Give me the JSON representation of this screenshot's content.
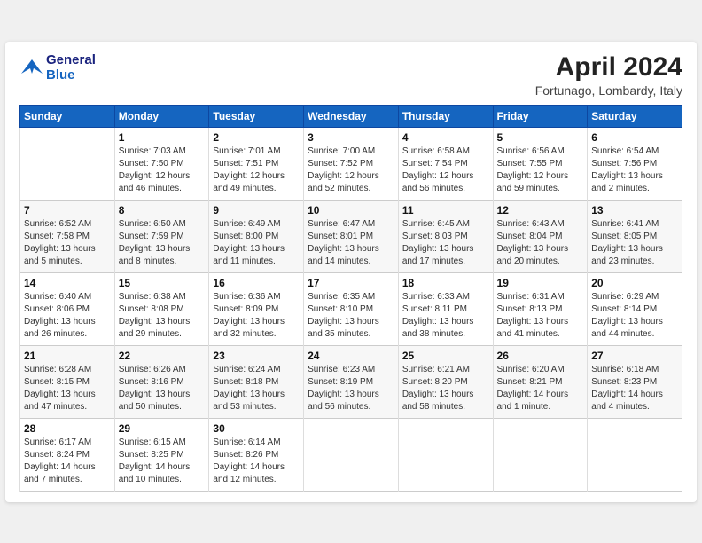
{
  "header": {
    "logo_line1": "General",
    "logo_line2": "Blue",
    "month": "April 2024",
    "location": "Fortunago, Lombardy, Italy"
  },
  "weekdays": [
    "Sunday",
    "Monday",
    "Tuesday",
    "Wednesday",
    "Thursday",
    "Friday",
    "Saturday"
  ],
  "weeks": [
    [
      {
        "day": "",
        "info": ""
      },
      {
        "day": "1",
        "info": "Sunrise: 7:03 AM\nSunset: 7:50 PM\nDaylight: 12 hours\nand 46 minutes."
      },
      {
        "day": "2",
        "info": "Sunrise: 7:01 AM\nSunset: 7:51 PM\nDaylight: 12 hours\nand 49 minutes."
      },
      {
        "day": "3",
        "info": "Sunrise: 7:00 AM\nSunset: 7:52 PM\nDaylight: 12 hours\nand 52 minutes."
      },
      {
        "day": "4",
        "info": "Sunrise: 6:58 AM\nSunset: 7:54 PM\nDaylight: 12 hours\nand 56 minutes."
      },
      {
        "day": "5",
        "info": "Sunrise: 6:56 AM\nSunset: 7:55 PM\nDaylight: 12 hours\nand 59 minutes."
      },
      {
        "day": "6",
        "info": "Sunrise: 6:54 AM\nSunset: 7:56 PM\nDaylight: 13 hours\nand 2 minutes."
      }
    ],
    [
      {
        "day": "7",
        "info": "Sunrise: 6:52 AM\nSunset: 7:58 PM\nDaylight: 13 hours\nand 5 minutes."
      },
      {
        "day": "8",
        "info": "Sunrise: 6:50 AM\nSunset: 7:59 PM\nDaylight: 13 hours\nand 8 minutes."
      },
      {
        "day": "9",
        "info": "Sunrise: 6:49 AM\nSunset: 8:00 PM\nDaylight: 13 hours\nand 11 minutes."
      },
      {
        "day": "10",
        "info": "Sunrise: 6:47 AM\nSunset: 8:01 PM\nDaylight: 13 hours\nand 14 minutes."
      },
      {
        "day": "11",
        "info": "Sunrise: 6:45 AM\nSunset: 8:03 PM\nDaylight: 13 hours\nand 17 minutes."
      },
      {
        "day": "12",
        "info": "Sunrise: 6:43 AM\nSunset: 8:04 PM\nDaylight: 13 hours\nand 20 minutes."
      },
      {
        "day": "13",
        "info": "Sunrise: 6:41 AM\nSunset: 8:05 PM\nDaylight: 13 hours\nand 23 minutes."
      }
    ],
    [
      {
        "day": "14",
        "info": "Sunrise: 6:40 AM\nSunset: 8:06 PM\nDaylight: 13 hours\nand 26 minutes."
      },
      {
        "day": "15",
        "info": "Sunrise: 6:38 AM\nSunset: 8:08 PM\nDaylight: 13 hours\nand 29 minutes."
      },
      {
        "day": "16",
        "info": "Sunrise: 6:36 AM\nSunset: 8:09 PM\nDaylight: 13 hours\nand 32 minutes."
      },
      {
        "day": "17",
        "info": "Sunrise: 6:35 AM\nSunset: 8:10 PM\nDaylight: 13 hours\nand 35 minutes."
      },
      {
        "day": "18",
        "info": "Sunrise: 6:33 AM\nSunset: 8:11 PM\nDaylight: 13 hours\nand 38 minutes."
      },
      {
        "day": "19",
        "info": "Sunrise: 6:31 AM\nSunset: 8:13 PM\nDaylight: 13 hours\nand 41 minutes."
      },
      {
        "day": "20",
        "info": "Sunrise: 6:29 AM\nSunset: 8:14 PM\nDaylight: 13 hours\nand 44 minutes."
      }
    ],
    [
      {
        "day": "21",
        "info": "Sunrise: 6:28 AM\nSunset: 8:15 PM\nDaylight: 13 hours\nand 47 minutes."
      },
      {
        "day": "22",
        "info": "Sunrise: 6:26 AM\nSunset: 8:16 PM\nDaylight: 13 hours\nand 50 minutes."
      },
      {
        "day": "23",
        "info": "Sunrise: 6:24 AM\nSunset: 8:18 PM\nDaylight: 13 hours\nand 53 minutes."
      },
      {
        "day": "24",
        "info": "Sunrise: 6:23 AM\nSunset: 8:19 PM\nDaylight: 13 hours\nand 56 minutes."
      },
      {
        "day": "25",
        "info": "Sunrise: 6:21 AM\nSunset: 8:20 PM\nDaylight: 13 hours\nand 58 minutes."
      },
      {
        "day": "26",
        "info": "Sunrise: 6:20 AM\nSunset: 8:21 PM\nDaylight: 14 hours\nand 1 minute."
      },
      {
        "day": "27",
        "info": "Sunrise: 6:18 AM\nSunset: 8:23 PM\nDaylight: 14 hours\nand 4 minutes."
      }
    ],
    [
      {
        "day": "28",
        "info": "Sunrise: 6:17 AM\nSunset: 8:24 PM\nDaylight: 14 hours\nand 7 minutes."
      },
      {
        "day": "29",
        "info": "Sunrise: 6:15 AM\nSunset: 8:25 PM\nDaylight: 14 hours\nand 10 minutes."
      },
      {
        "day": "30",
        "info": "Sunrise: 6:14 AM\nSunset: 8:26 PM\nDaylight: 14 hours\nand 12 minutes."
      },
      {
        "day": "",
        "info": ""
      },
      {
        "day": "",
        "info": ""
      },
      {
        "day": "",
        "info": ""
      },
      {
        "day": "",
        "info": ""
      }
    ]
  ]
}
